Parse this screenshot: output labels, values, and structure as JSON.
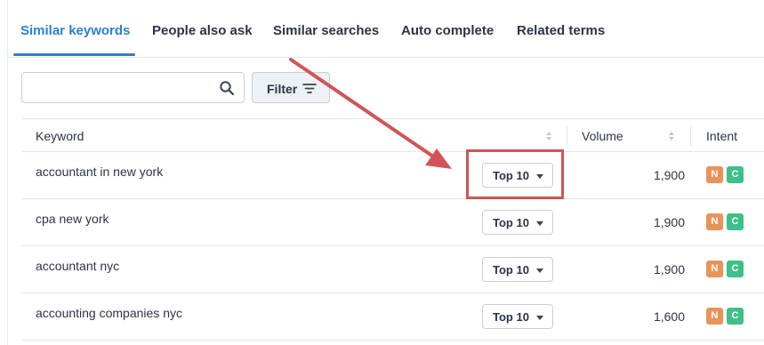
{
  "tabs": [
    {
      "label": "Similar keywords",
      "active": true
    },
    {
      "label": "People also ask",
      "active": false
    },
    {
      "label": "Similar searches",
      "active": false
    },
    {
      "label": "Auto complete",
      "active": false
    },
    {
      "label": "Related terms",
      "active": false
    }
  ],
  "search": {
    "value": "",
    "placeholder": "",
    "icon": "search-icon"
  },
  "filter": {
    "label": "Filter",
    "icon": "filter-lines-icon"
  },
  "table": {
    "headers": {
      "keyword": "Keyword",
      "volume": "Volume",
      "intent": "Intent"
    },
    "rows": [
      {
        "keyword": "accountant in new york",
        "position": "Top 10",
        "volume": "1,900",
        "intents": [
          "N",
          "C"
        ]
      },
      {
        "keyword": "cpa new york",
        "position": "Top 10",
        "volume": "1,900",
        "intents": [
          "N",
          "C"
        ]
      },
      {
        "keyword": "accountant nyc",
        "position": "Top 10",
        "volume": "1,900",
        "intents": [
          "N",
          "C"
        ]
      },
      {
        "keyword": "accounting companies nyc",
        "position": "Top 10",
        "volume": "1,600",
        "intents": [
          "N",
          "C"
        ]
      }
    ]
  },
  "colors": {
    "accent": "#2c7fd8",
    "intent_n": "#e8935a",
    "intent_c": "#3fbf8a",
    "annotation": "#d25454"
  }
}
